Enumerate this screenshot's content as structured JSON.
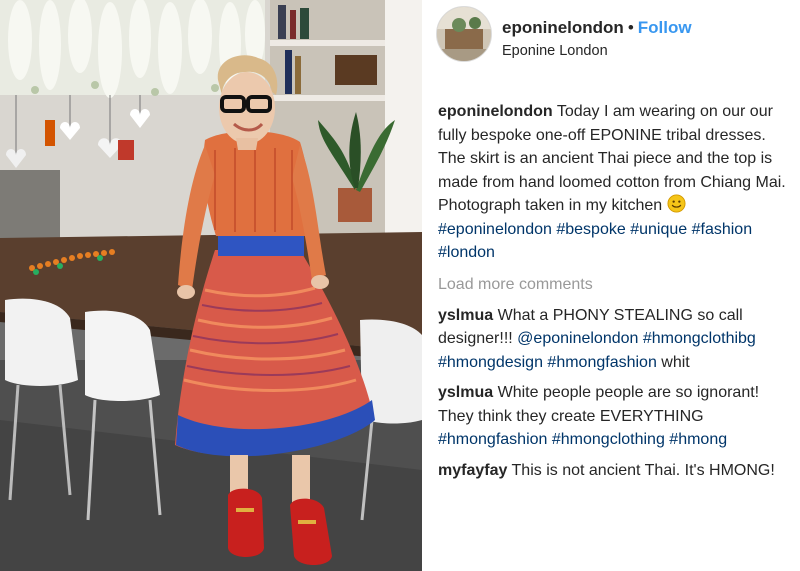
{
  "post": {
    "username": "eponinelondon",
    "separator": "•",
    "follow_label": "Follow",
    "location": "Eponine London",
    "caption": {
      "username": "eponinelondon",
      "text": "Today I am wearing on our our fully bespoke one-off EPONINE tribal dresses. The skirt is an ancient Thai piece and the top is made from hand loomed cotton from Chiang Mai. Photograph taken in my kitchen",
      "emoji": "smiling-face-emoji",
      "hashtags": [
        "#eponinelondon",
        "#bespoke",
        "#unique",
        "#fashion",
        "#london"
      ]
    },
    "load_more": "Load more comments"
  },
  "comments": [
    {
      "username": "yslmua",
      "text": "What a PHONY STEALING so call designer!!!",
      "mention": "@eponinelondon",
      "hashtags": [
        "#hmongclothibg",
        "#hmongdesign",
        "#hmongfashion"
      ],
      "trailing": "whit"
    },
    {
      "username": "yslmua",
      "text": "White people people are so ignorant! They think they create EVERYTHING",
      "hashtags": [
        "#hmongfashion",
        "#hmongclothing",
        "#hmong"
      ]
    },
    {
      "username": "myfayfay",
      "text": "This is not ancient Thai. It's HMONG!"
    }
  ],
  "colors": {
    "link": "#003569",
    "follow": "#3897f0",
    "muted": "#999999",
    "text": "#262626"
  }
}
